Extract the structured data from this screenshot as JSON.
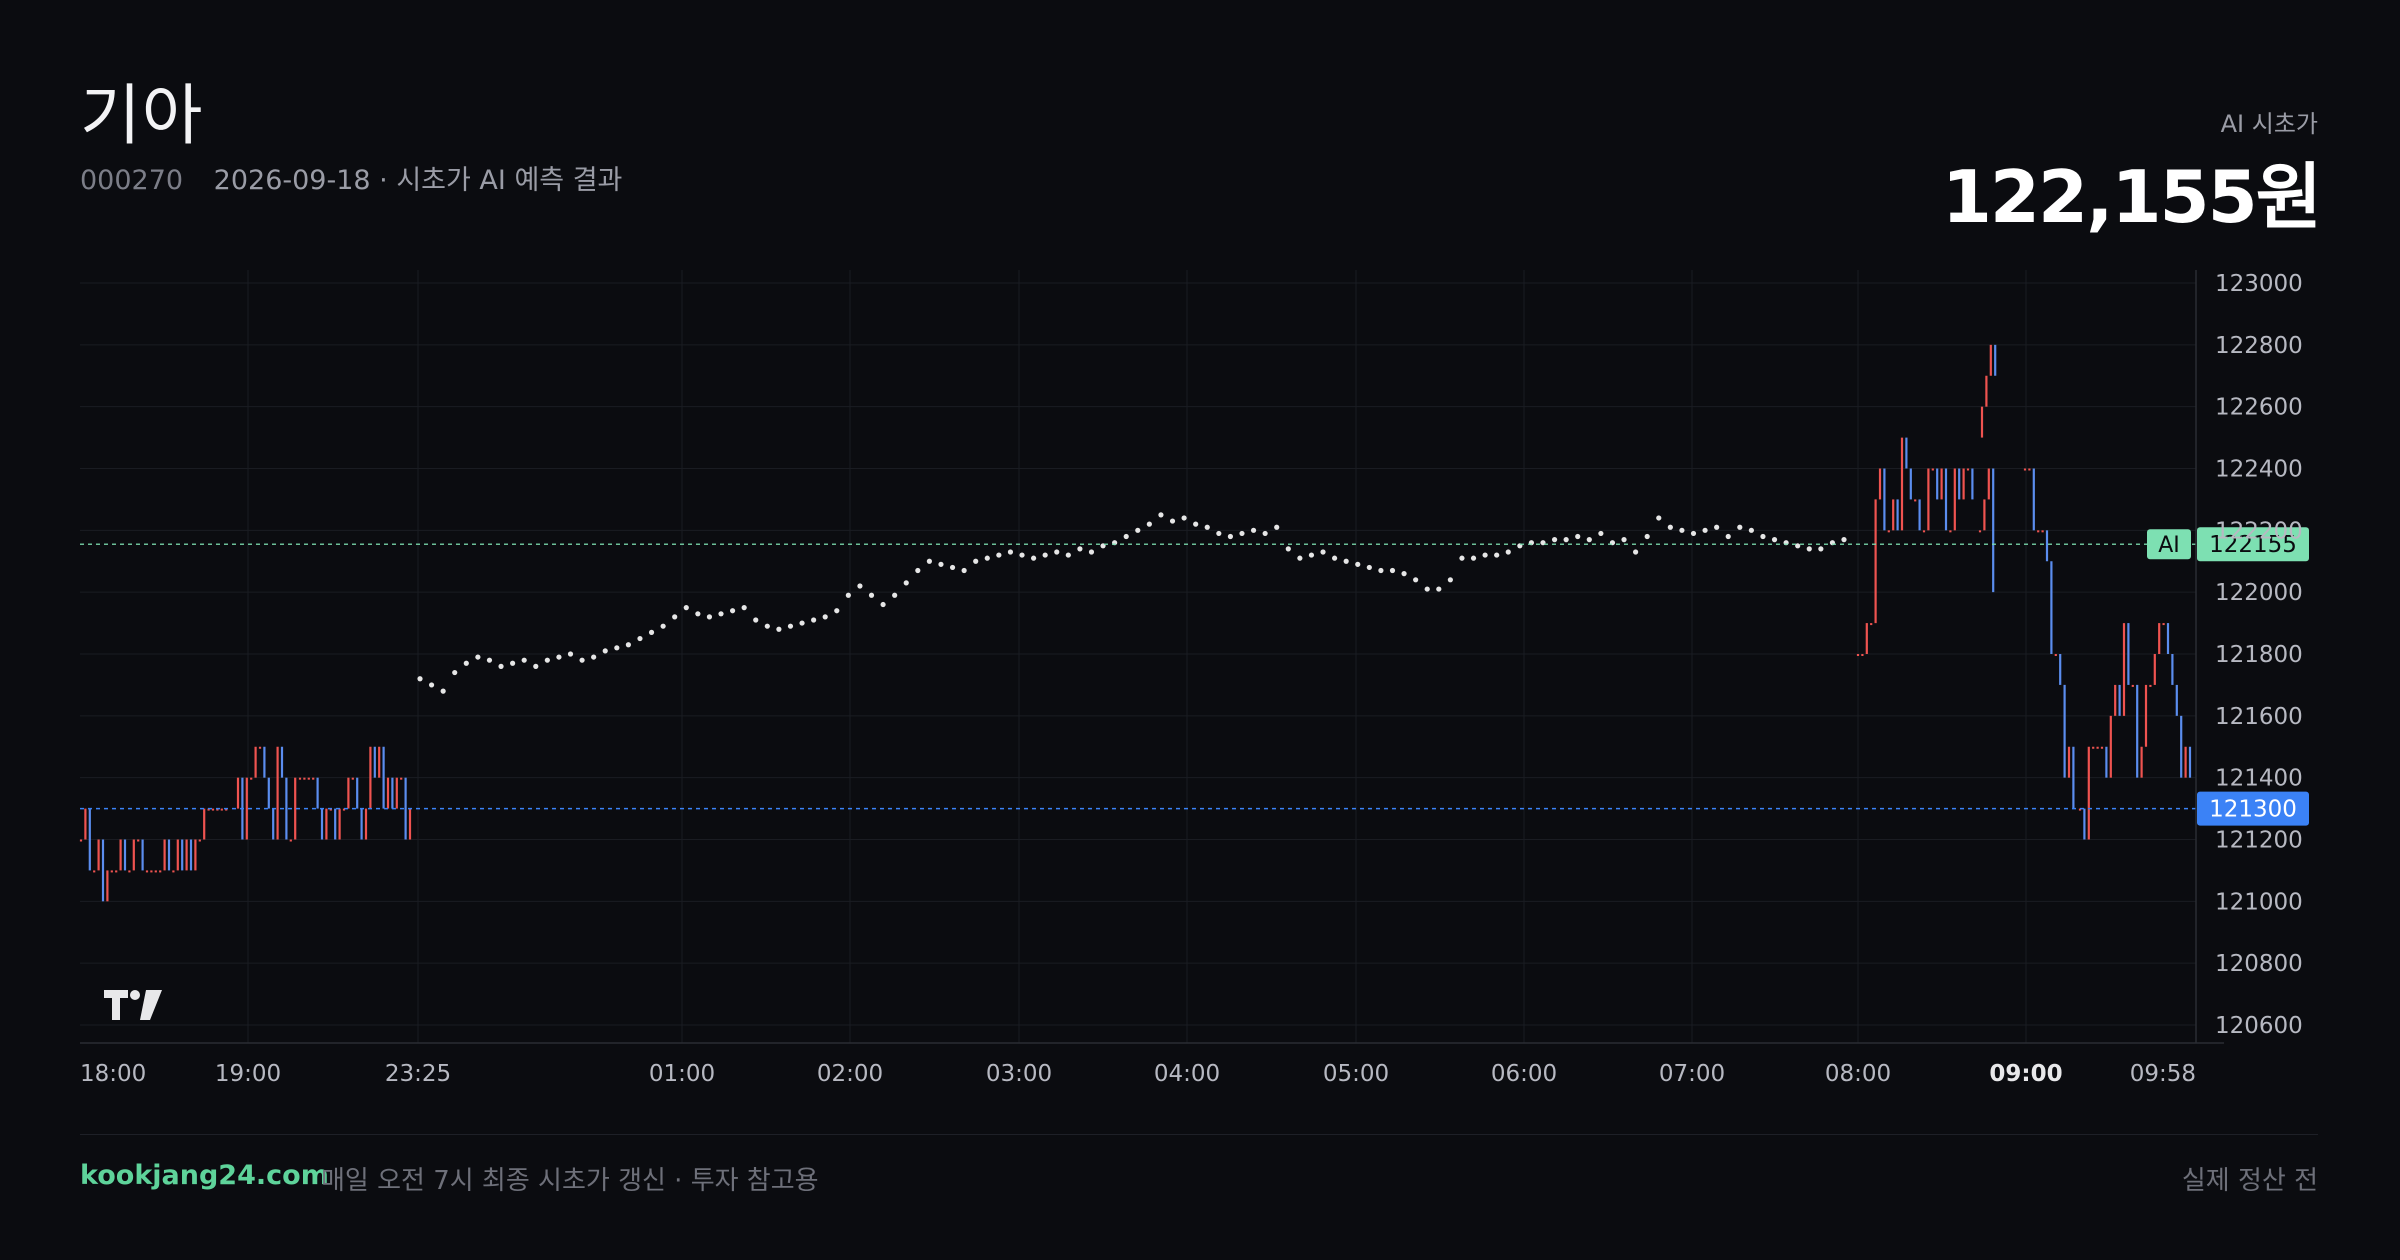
{
  "header": {
    "title": "기아",
    "code": "000270",
    "subtitle": "2026-09-18 · 시초가 AI 예측 결과"
  },
  "prediction": {
    "label": "AI 시초가",
    "value": "122,155원"
  },
  "footer": {
    "site": "kookjang24.com",
    "note": "매일 오전 7시 최종 시초가 갱신 · 투자 참고용",
    "status": "실제 정산 전"
  },
  "colors": {
    "background": "#0b0c10",
    "up": "#ef5350",
    "down": "#5b8def",
    "ai_line": "#7de0b2",
    "ai_badge": "#7de0b2",
    "current_badge": "#3b82f6",
    "grid": "#1a1c22",
    "dots": "#e6e6e6"
  },
  "icons": {
    "logo": "tradingview-logo"
  },
  "chart_data": {
    "type": "line",
    "title": "",
    "xlabel": "",
    "ylabel": "",
    "ylim": [
      120550,
      123050
    ],
    "y_ticks": [
      "123000",
      "122800",
      "122600",
      "122400",
      "122200",
      "122000",
      "121800",
      "121600",
      "121400",
      "121200",
      "121000",
      "120800",
      "120600"
    ],
    "x_ticks": [
      "18:00",
      "19:00",
      "23:25",
      "01:00",
      "02:00",
      "03:00",
      "04:00",
      "05:00",
      "06:00",
      "07:00",
      "08:00",
      "09:00",
      "09:58"
    ],
    "x_ticks_bold": [
      "09:00"
    ],
    "grid": true,
    "markers": {
      "ai": {
        "label": "AI",
        "value": 122155
      },
      "current": {
        "value": 121300
      }
    },
    "series": [
      {
        "style": "dots",
        "x_start": "23:25",
        "x_end": "07:55",
        "values": [
          121720,
          121700,
          121680,
          121740,
          121770,
          121790,
          121780,
          121760,
          121770,
          121780,
          121760,
          121780,
          121790,
          121800,
          121780,
          121790,
          121810,
          121820,
          121830,
          121850,
          121870,
          121890,
          121920,
          121950,
          121930,
          121920,
          121930,
          121940,
          121950,
          121910,
          121890,
          121880,
          121890,
          121900,
          121910,
          121920,
          121940,
          121990,
          122020,
          121990,
          121960,
          121990,
          122030,
          122070,
          122100,
          122090,
          122080,
          122070,
          122100,
          122110,
          122120,
          122130,
          122120,
          122110,
          122120,
          122130,
          122120,
          122140,
          122130,
          122150,
          122160,
          122180,
          122200,
          122220,
          122250,
          122230,
          122240,
          122220,
          122210,
          122190,
          122180,
          122190,
          122200,
          122190,
          122210,
          122140,
          122110,
          122120,
          122130,
          122110,
          122100,
          122090,
          122080,
          122070,
          122070,
          122060,
          122040,
          122010,
          122010,
          122040,
          122110,
          122110,
          122120,
          122120,
          122130,
          122150,
          122160,
          122160,
          122170,
          122170,
          122180,
          122170,
          122190,
          122160,
          122170,
          122130,
          122180,
          122240,
          122210,
          122200,
          122190,
          122200,
          122210,
          122180,
          122210,
          122200,
          122180,
          122170,
          122160,
          122150,
          122140,
          122140,
          122160,
          122170
        ]
      },
      {
        "style": "candles-pre",
        "x_start": "18:00",
        "x_end": "19:50",
        "note": "thin bars oscillating 121100-121500"
      },
      {
        "style": "candles-market",
        "x_start": "08:00",
        "x_end": "09:58",
        "note": "thin bars 121200-122800"
      }
    ]
  }
}
